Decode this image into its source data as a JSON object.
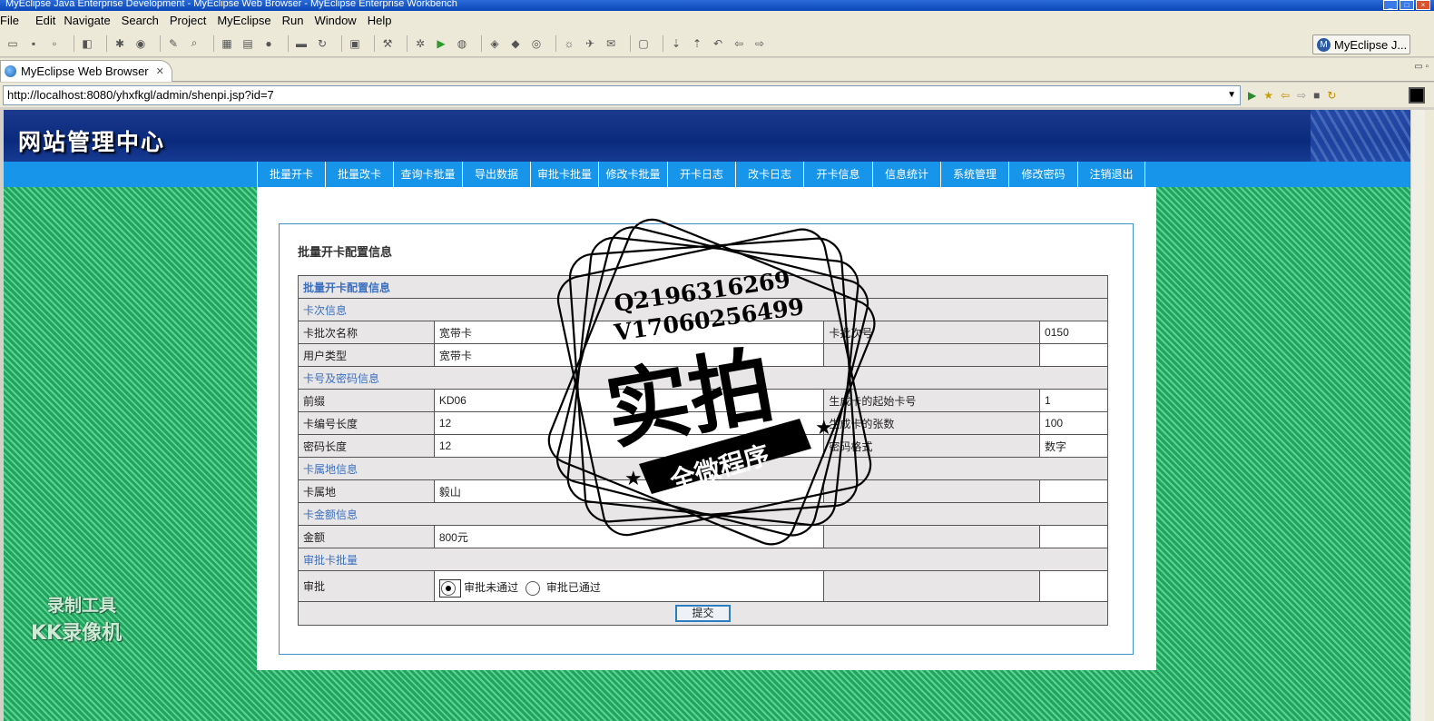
{
  "window": {
    "title": "MyEclipse Java Enterprise Development - MyEclipse Web Browser - MyEclipse Enterprise Workbench"
  },
  "menu": [
    "File",
    "Edit",
    "Navigate",
    "Search",
    "Project",
    "MyEclipse",
    "Run",
    "Window",
    "Help"
  ],
  "perspective": {
    "label": "MyEclipse J..."
  },
  "editor_tab": {
    "label": "MyEclipse Web Browser"
  },
  "url": "http://localhost:8080/yhxfkgl/admin/shenpi.jsp?id=7",
  "site": {
    "logo": "网站管理中心",
    "nav": [
      "批量开卡",
      "批量改卡",
      "查询卡批量",
      "导出数据",
      "审批卡批量",
      "修改卡批量",
      "开卡日志",
      "改卡日志",
      "开卡信息",
      "信息统计",
      "系统管理",
      "修改密码",
      "注销退出"
    ]
  },
  "form": {
    "page_title": "批量开卡配置信息",
    "table_title": "批量开卡配置信息",
    "sections": {
      "batch": "卡次信息",
      "cardpw": "卡号及密码信息",
      "location": "卡属地信息",
      "amount": "卡金额信息",
      "approval": "审批卡批量"
    },
    "rows": {
      "batch_name_label": "卡批次名称",
      "batch_name": "宽带卡",
      "batch_no_label": "卡批次号",
      "batch_no": "0150",
      "user_type_label": "用户类型",
      "user_type": "宽带卡",
      "prefix_label": "前缀",
      "prefix": "KD06",
      "start_no_label": "生成卡的起始卡号",
      "start_no": "1",
      "card_len_label": "卡编号长度",
      "card_len": "12",
      "count_label": "生成卡的张数",
      "count": "100",
      "pw_len_label": "密码长度",
      "pw_len": "12",
      "pw_fmt_label": "密码格式",
      "pw_fmt": "数字",
      "loc_label": "卡属地",
      "loc": "毅山",
      "amount_label": "金额",
      "amount": "800元",
      "approve_label": "审批",
      "opt_reject": "审批未通过",
      "opt_pass": "审批已通过"
    },
    "submit": "提交"
  },
  "overlay": {
    "qq": "Q2196316269",
    "wx": "V17060256499",
    "stamp_main": "实拍",
    "stamp_ribbon": "全微程序"
  },
  "recorder_watermark": {
    "line1": "录制工具",
    "line2": "KK录像机"
  }
}
